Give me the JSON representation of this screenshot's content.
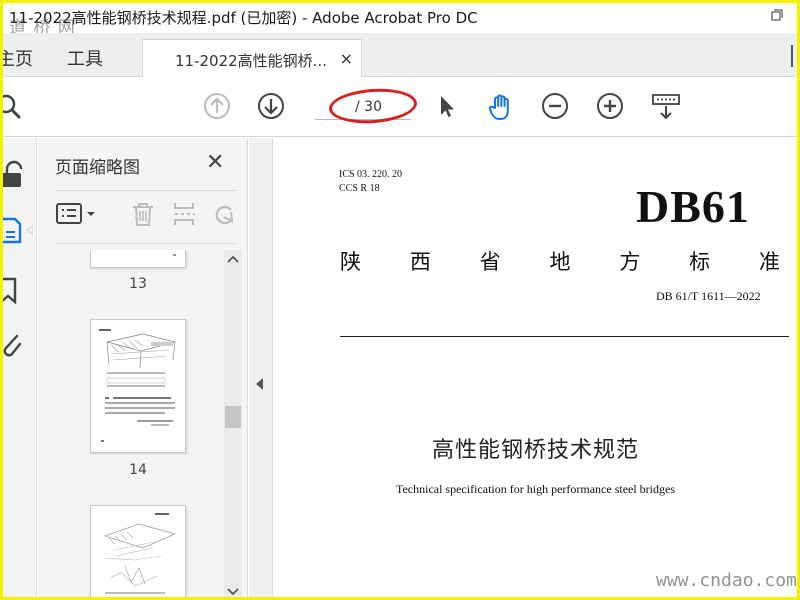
{
  "window": {
    "title": "11-2022高性能钢桥技术规程.pdf (已加密) - Adobe Acrobat Pro DC",
    "watermark_top": "道 桥 网"
  },
  "tabs": {
    "home": "主页",
    "tools": "工具",
    "document": "11-2022高性能钢桥...",
    "close_glyph": "×"
  },
  "toolbar": {
    "page_total": "/ 30",
    "icons": [
      "arrow-up-circle-icon",
      "arrow-down-circle-icon",
      "select-pointer-icon",
      "hand-tool-icon",
      "zoom-out-icon",
      "zoom-in-icon",
      "page-view-icon"
    ],
    "active_tool": "hand-tool-icon",
    "accent_color": "#1473e6",
    "annotation_color": "#d62020"
  },
  "rail": {
    "icons": [
      "lock-icon",
      "page-thumbnails-icon",
      "bookmark-icon",
      "attachment-icon"
    ]
  },
  "thumbnails_panel": {
    "title": "页面缩略图",
    "close_glyph": "✕",
    "pages": [
      {
        "number": "13"
      },
      {
        "number": "14"
      },
      {
        "number": ""
      }
    ]
  },
  "document": {
    "ics": "ICS  03. 220. 20",
    "ccs": "CCS  R  18",
    "code": "DB61",
    "authority_chars": [
      "陕",
      "西",
      "省",
      "地",
      "方",
      "标",
      "准"
    ],
    "standard_number": "DB 61/T  1611—2022",
    "title_cn": "高性能钢桥技术规范",
    "title_en": "Technical specification for high performance steel bridges",
    "watermark": "www.cndao.com"
  }
}
